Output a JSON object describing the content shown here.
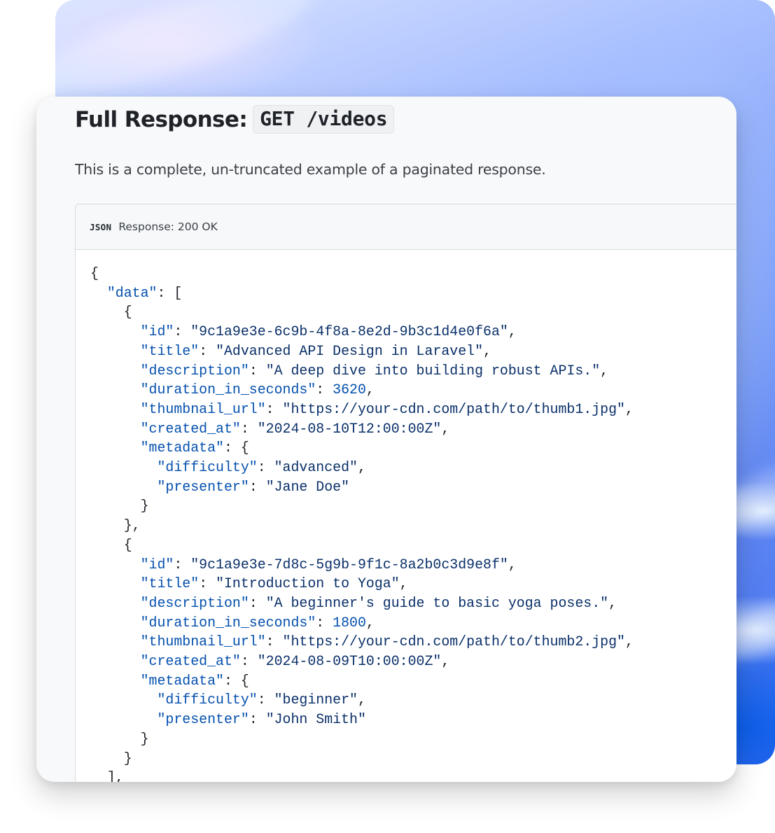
{
  "page": {
    "title_text": "Full Response:",
    "title_code": "GET /videos",
    "intro": "This is a complete, un-truncated example of a paginated response."
  },
  "code_block": {
    "language_badge": "JSON",
    "response_label": "Response: 200 OK",
    "lines": [
      [
        {
          "t": "{",
          "c": "punct"
        }
      ],
      [
        {
          "t": "  ",
          "c": "punct"
        },
        {
          "t": "\"data\"",
          "c": "key"
        },
        {
          "t": ": [",
          "c": "punct"
        }
      ],
      [
        {
          "t": "    {",
          "c": "punct"
        }
      ],
      [
        {
          "t": "      ",
          "c": "punct"
        },
        {
          "t": "\"id\"",
          "c": "key"
        },
        {
          "t": ": ",
          "c": "punct"
        },
        {
          "t": "\"9c1a9e3e-6c9b-4f8a-8e2d-9b3c1d4e0f6a\"",
          "c": "str"
        },
        {
          "t": ",",
          "c": "punct"
        }
      ],
      [
        {
          "t": "      ",
          "c": "punct"
        },
        {
          "t": "\"title\"",
          "c": "key"
        },
        {
          "t": ": ",
          "c": "punct"
        },
        {
          "t": "\"Advanced API Design in Laravel\"",
          "c": "str"
        },
        {
          "t": ",",
          "c": "punct"
        }
      ],
      [
        {
          "t": "      ",
          "c": "punct"
        },
        {
          "t": "\"description\"",
          "c": "key"
        },
        {
          "t": ": ",
          "c": "punct"
        },
        {
          "t": "\"A deep dive into building robust APIs.\"",
          "c": "str"
        },
        {
          "t": ",",
          "c": "punct"
        }
      ],
      [
        {
          "t": "      ",
          "c": "punct"
        },
        {
          "t": "\"duration_in_seconds\"",
          "c": "key"
        },
        {
          "t": ": ",
          "c": "punct"
        },
        {
          "t": "3620",
          "c": "num"
        },
        {
          "t": ",",
          "c": "punct"
        }
      ],
      [
        {
          "t": "      ",
          "c": "punct"
        },
        {
          "t": "\"thumbnail_url\"",
          "c": "key"
        },
        {
          "t": ": ",
          "c": "punct"
        },
        {
          "t": "\"https://your-cdn.com/path/to/thumb1.jpg\"",
          "c": "str"
        },
        {
          "t": ",",
          "c": "punct"
        }
      ],
      [
        {
          "t": "      ",
          "c": "punct"
        },
        {
          "t": "\"created_at\"",
          "c": "key"
        },
        {
          "t": ": ",
          "c": "punct"
        },
        {
          "t": "\"2024-08-10T12:00:00Z\"",
          "c": "str"
        },
        {
          "t": ",",
          "c": "punct"
        }
      ],
      [
        {
          "t": "      ",
          "c": "punct"
        },
        {
          "t": "\"metadata\"",
          "c": "key"
        },
        {
          "t": ": {",
          "c": "punct"
        }
      ],
      [
        {
          "t": "        ",
          "c": "punct"
        },
        {
          "t": "\"difficulty\"",
          "c": "key"
        },
        {
          "t": ": ",
          "c": "punct"
        },
        {
          "t": "\"advanced\"",
          "c": "str"
        },
        {
          "t": ",",
          "c": "punct"
        }
      ],
      [
        {
          "t": "        ",
          "c": "punct"
        },
        {
          "t": "\"presenter\"",
          "c": "key"
        },
        {
          "t": ": ",
          "c": "punct"
        },
        {
          "t": "\"Jane Doe\"",
          "c": "str"
        }
      ],
      [
        {
          "t": "      }",
          "c": "punct"
        }
      ],
      [
        {
          "t": "    },",
          "c": "punct"
        }
      ],
      [
        {
          "t": "    {",
          "c": "punct"
        }
      ],
      [
        {
          "t": "      ",
          "c": "punct"
        },
        {
          "t": "\"id\"",
          "c": "key"
        },
        {
          "t": ": ",
          "c": "punct"
        },
        {
          "t": "\"9c1a9e3e-7d8c-5g9b-9f1c-8a2b0c3d9e8f\"",
          "c": "str"
        },
        {
          "t": ",",
          "c": "punct"
        }
      ],
      [
        {
          "t": "      ",
          "c": "punct"
        },
        {
          "t": "\"title\"",
          "c": "key"
        },
        {
          "t": ": ",
          "c": "punct"
        },
        {
          "t": "\"Introduction to Yoga\"",
          "c": "str"
        },
        {
          "t": ",",
          "c": "punct"
        }
      ],
      [
        {
          "t": "      ",
          "c": "punct"
        },
        {
          "t": "\"description\"",
          "c": "key"
        },
        {
          "t": ": ",
          "c": "punct"
        },
        {
          "t": "\"A beginner's guide to basic yoga poses.\"",
          "c": "str"
        },
        {
          "t": ",",
          "c": "punct"
        }
      ],
      [
        {
          "t": "      ",
          "c": "punct"
        },
        {
          "t": "\"duration_in_seconds\"",
          "c": "key"
        },
        {
          "t": ": ",
          "c": "punct"
        },
        {
          "t": "1800",
          "c": "num"
        },
        {
          "t": ",",
          "c": "punct"
        }
      ],
      [
        {
          "t": "      ",
          "c": "punct"
        },
        {
          "t": "\"thumbnail_url\"",
          "c": "key"
        },
        {
          "t": ": ",
          "c": "punct"
        },
        {
          "t": "\"https://your-cdn.com/path/to/thumb2.jpg\"",
          "c": "str"
        },
        {
          "t": ",",
          "c": "punct"
        }
      ],
      [
        {
          "t": "      ",
          "c": "punct"
        },
        {
          "t": "\"created_at\"",
          "c": "key"
        },
        {
          "t": ": ",
          "c": "punct"
        },
        {
          "t": "\"2024-08-09T10:00:00Z\"",
          "c": "str"
        },
        {
          "t": ",",
          "c": "punct"
        }
      ],
      [
        {
          "t": "      ",
          "c": "punct"
        },
        {
          "t": "\"metadata\"",
          "c": "key"
        },
        {
          "t": ": {",
          "c": "punct"
        }
      ],
      [
        {
          "t": "        ",
          "c": "punct"
        },
        {
          "t": "\"difficulty\"",
          "c": "key"
        },
        {
          "t": ": ",
          "c": "punct"
        },
        {
          "t": "\"beginner\"",
          "c": "str"
        },
        {
          "t": ",",
          "c": "punct"
        }
      ],
      [
        {
          "t": "        ",
          "c": "punct"
        },
        {
          "t": "\"presenter\"",
          "c": "key"
        },
        {
          "t": ": ",
          "c": "punct"
        },
        {
          "t": "\"John Smith\"",
          "c": "str"
        }
      ],
      [
        {
          "t": "      }",
          "c": "punct"
        }
      ],
      [
        {
          "t": "    }",
          "c": "punct"
        }
      ],
      [
        {
          "t": "  ],",
          "c": "punct"
        }
      ]
    ]
  },
  "colors": {
    "key": "#0550ae",
    "number": "#0550ae",
    "string": "#0a3069",
    "punctuation": "#1f2328"
  }
}
